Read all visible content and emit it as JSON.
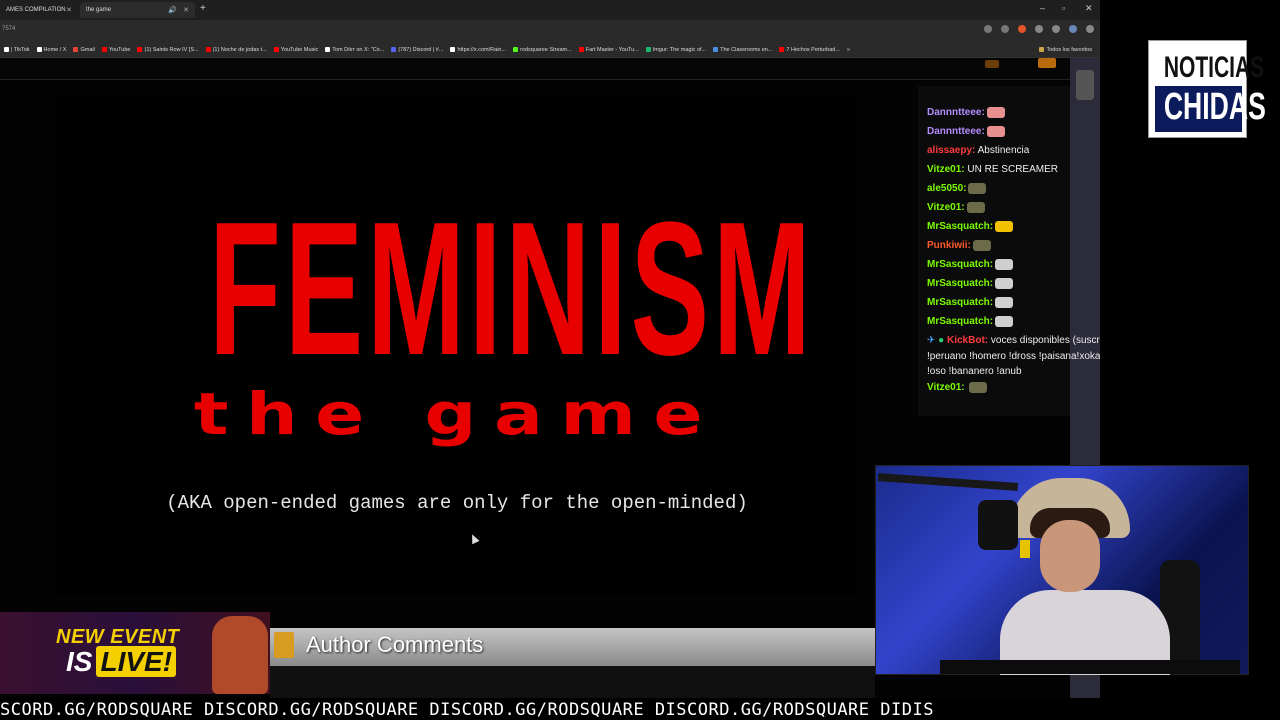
{
  "browser": {
    "tabs": [
      {
        "label": "AMES COMPILATION"
      },
      {
        "label": "the game"
      }
    ],
    "url": "7574",
    "bookmarks": [
      {
        "label": "| TikTok",
        "color": "#fff"
      },
      {
        "label": "Home / X",
        "color": "#fff"
      },
      {
        "label": "Gmail",
        "color": "#ea4335"
      },
      {
        "label": "YouTube",
        "color": "#ff0000"
      },
      {
        "label": "(1) Saints Row IV [S...",
        "color": "#ff0000"
      },
      {
        "label": "(1) Noche de jodas t...",
        "color": "#ff0000"
      },
      {
        "label": "YouTube Music",
        "color": "#ff0000"
      },
      {
        "label": "Tom Dörr on X: \"Co...",
        "color": "#fff"
      },
      {
        "label": "(787) Discord | #...",
        "color": "#5865f2"
      },
      {
        "label": "https://x.com/Rain...",
        "color": "#fff"
      },
      {
        "label": "rodsquaree Stream...",
        "color": "#53fc18"
      },
      {
        "label": "Fart Master - YouTu...",
        "color": "#ff0000"
      },
      {
        "label": "Imgur: The magic of...",
        "color": "#1bb76e"
      },
      {
        "label": "The Classrooms en...",
        "color": "#4a90e2"
      },
      {
        "label": "7 Hechos Perturbad...",
        "color": "#ff0000"
      }
    ],
    "favorites_label": "Todos los favoritos"
  },
  "game": {
    "title": "FEMINISM",
    "subtitle": "the game",
    "tagline": "(AKA open-ended games are only for the open-minded)"
  },
  "chat": {
    "messages": [
      {
        "user": "Dannntteee:",
        "color": "#b58cff",
        "text": "",
        "emote": "#e89090"
      },
      {
        "user": "Dannntteee:",
        "color": "#b58cff",
        "text": "",
        "emote": "#e89090"
      },
      {
        "user": "alissaepy:",
        "color": "#ff3b3b",
        "text": "Abstinencia",
        "emote": ""
      },
      {
        "user": "Vitze01:",
        "color": "#7cfc00",
        "text": "UN RE SCREAMER",
        "emote": ""
      },
      {
        "user": "ale5050:",
        "color": "#7cfc00",
        "text": "",
        "emote": "#6b6b4a"
      },
      {
        "user": "Vitze01:",
        "color": "#7cfc00",
        "text": "",
        "emote": "#6b6b4a"
      },
      {
        "user": "MrSasquatch:",
        "color": "#7cfc00",
        "text": "",
        "emote": "#f2c200"
      },
      {
        "user": "Punkiwii:",
        "color": "#ff5a2a",
        "text": "",
        "emote": "#6b6b4a"
      },
      {
        "user": "MrSasquatch:",
        "color": "#7cfc00",
        "text": "",
        "emote": "#cfcfcf"
      },
      {
        "user": "MrSasquatch:",
        "color": "#7cfc00",
        "text": "",
        "emote": "#cfcfcf"
      },
      {
        "user": "MrSasquatch:",
        "color": "#7cfc00",
        "text": "",
        "emote": "#cfcfcf"
      },
      {
        "user": "MrSasquatch:",
        "color": "#7cfc00",
        "text": "",
        "emote": "#cfcfcf"
      }
    ],
    "bot_user": "KickBot:",
    "bot_color": "#ff3b3b",
    "bot_text": "voces disponibles (suscriptores) !loquendo !peruano !homero !dross !paisana!xokas !gay !choche !mikari !oso !bananero !anub",
    "last_user": "Vitze01:",
    "last_color": "#7cfc00"
  },
  "logo": {
    "line1": "NOTICIAS",
    "line2": "CHIDAS"
  },
  "event": {
    "line1": "NEW EVENT",
    "line2_a": "IS",
    "line2_b": "LIVE!"
  },
  "author_comments": {
    "title": "Author Comments"
  },
  "ticker": {
    "text": "SCORD.GG/RODSQUARE DISCORD.GG/RODSQUARE DISCORD.GG/RODSQUARE DISCORD.GG/RODSQUARE DIDIS"
  }
}
